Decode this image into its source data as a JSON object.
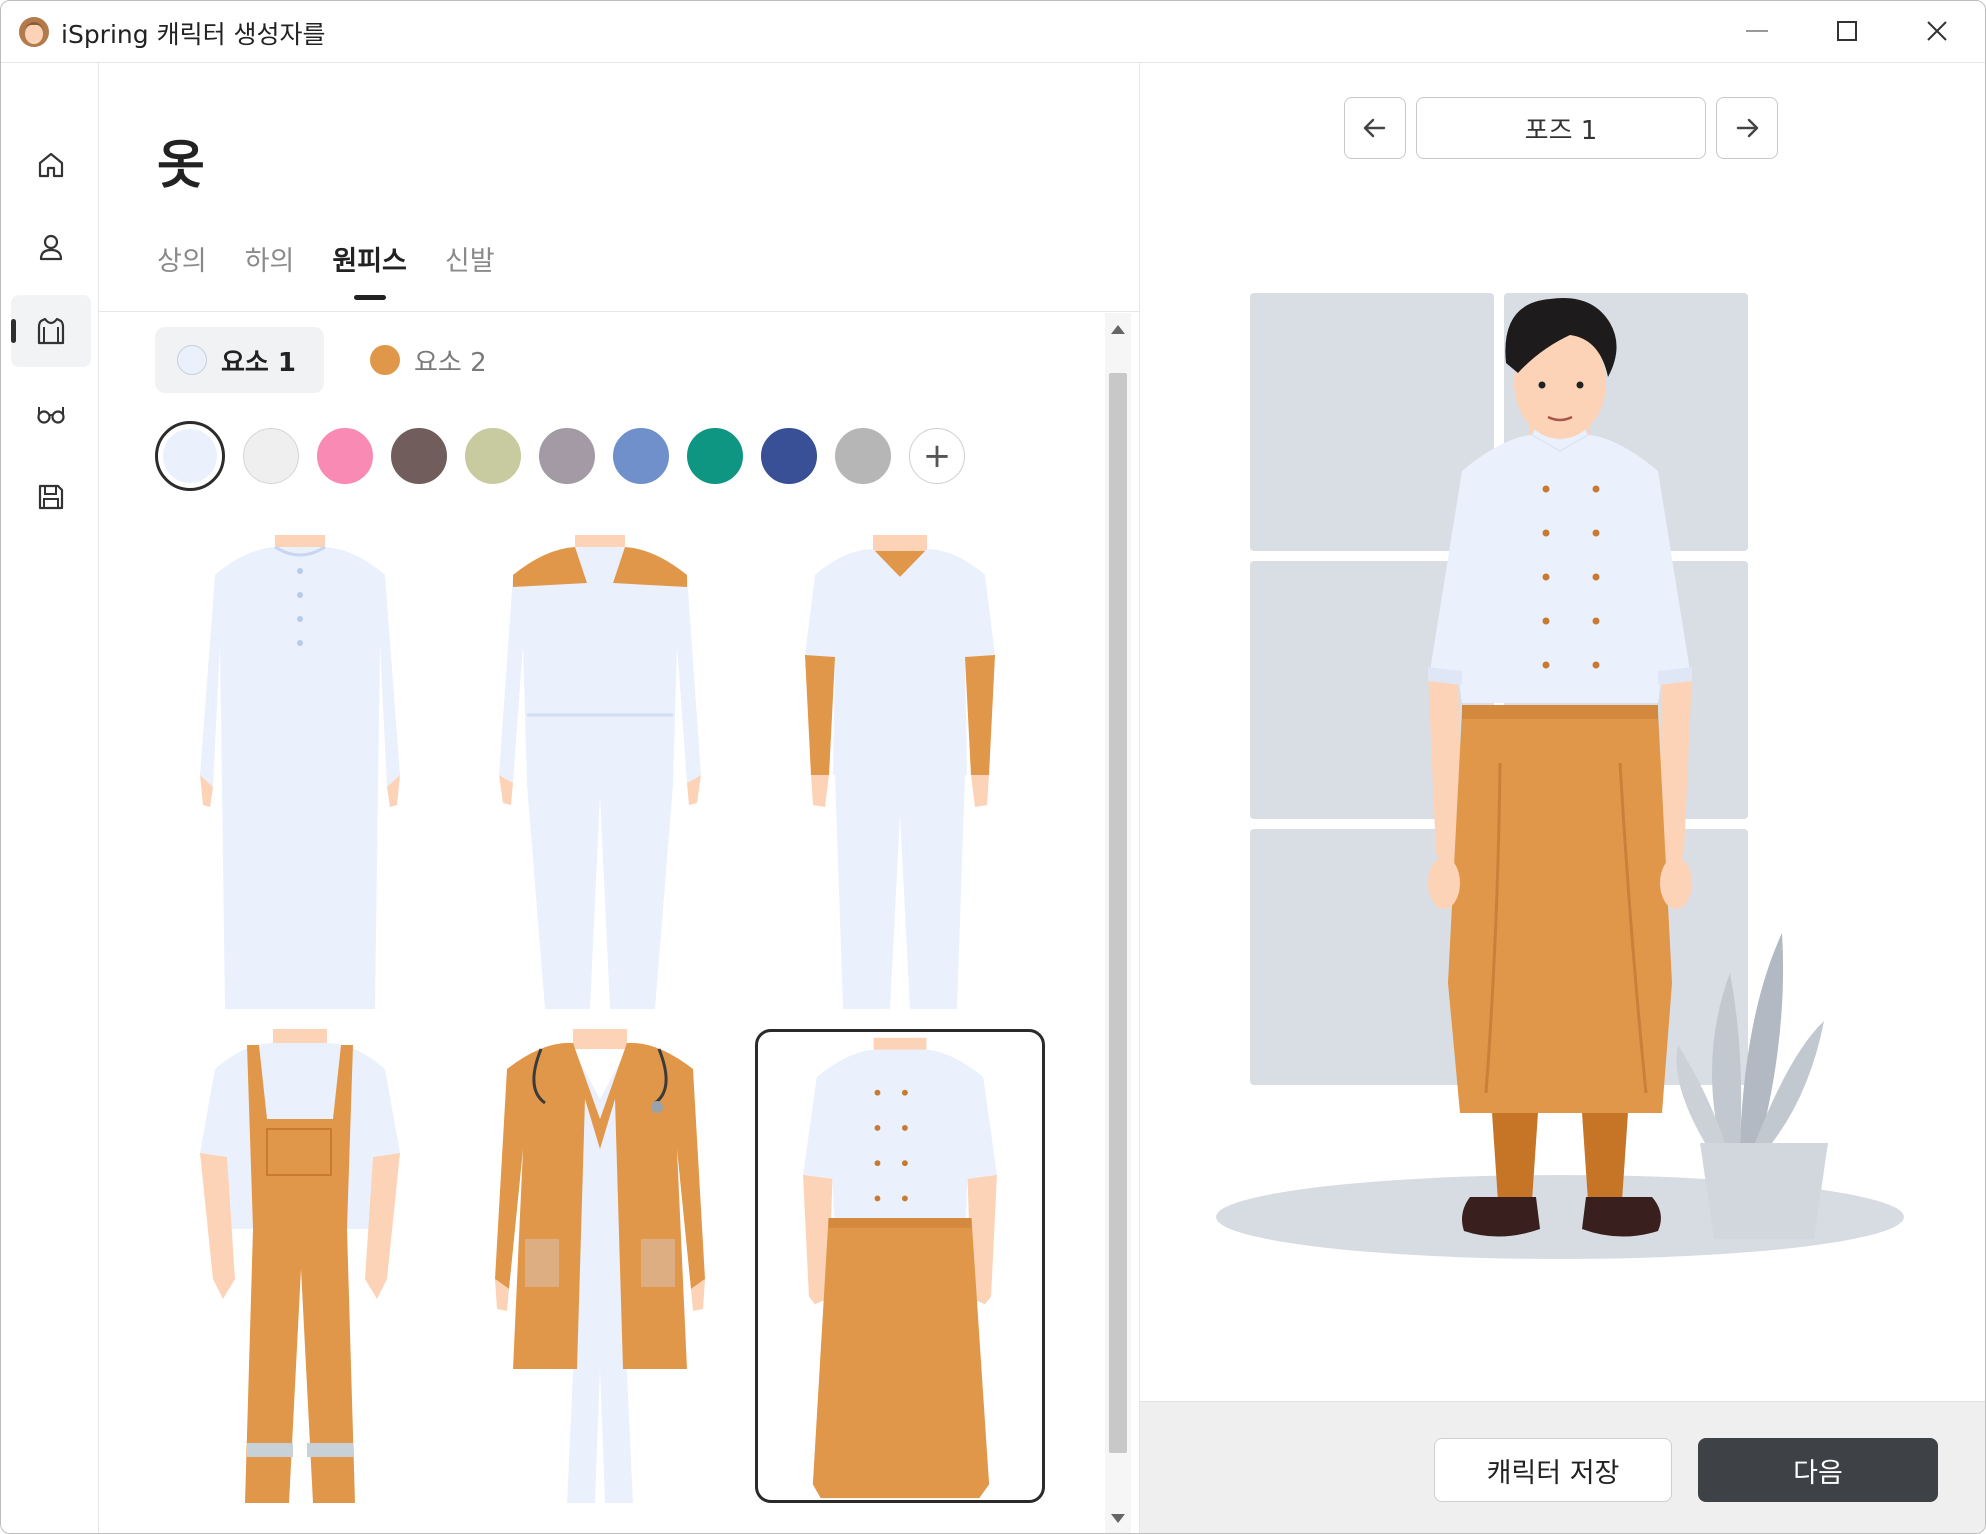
{
  "window": {
    "title": "iSpring 캐릭터 생성자를"
  },
  "sidebar": {
    "items": [
      {
        "name": "home",
        "icon": "home-icon",
        "active": false
      },
      {
        "name": "character",
        "icon": "person-icon",
        "active": false
      },
      {
        "name": "clothes",
        "icon": "shirt-icon",
        "active": true
      },
      {
        "name": "accessories",
        "icon": "glasses-icon",
        "active": false
      },
      {
        "name": "save",
        "icon": "save-icon",
        "active": false
      }
    ]
  },
  "panel": {
    "title": "옷",
    "tabs": [
      {
        "label": "상의",
        "active": false
      },
      {
        "label": "하의",
        "active": false
      },
      {
        "label": "원피스",
        "active": true
      },
      {
        "label": "신발",
        "active": false
      }
    ],
    "elements": [
      {
        "label": "요소 1",
        "color": "#eaf1fd",
        "active": true
      },
      {
        "label": "요소 2",
        "color": "#e0974a",
        "active": false
      }
    ],
    "swatches": [
      "#eaf1fd",
      "#efefef",
      "#f88ab3",
      "#715d5c",
      "#c8ca9f",
      "#a39aa6",
      "#7090cc",
      "#0f9683",
      "#394f96",
      "#b6b6b6"
    ],
    "selected_swatch": "#eaf1fd",
    "add_swatch_icon": "plus-icon",
    "outfits": [
      {
        "id": "long-robe",
        "selected": false
      },
      {
        "id": "jumpsuit",
        "selected": false
      },
      {
        "id": "scrubs",
        "selected": false
      },
      {
        "id": "overalls",
        "selected": false
      },
      {
        "id": "doctor-coat",
        "selected": false
      },
      {
        "id": "chef-apron",
        "selected": true
      }
    ]
  },
  "preview": {
    "pose_label": "포즈 1",
    "prev_icon": "arrow-left-icon",
    "next_icon": "arrow-right-icon",
    "save_label": "캐릭터 저장",
    "next_label": "다음"
  },
  "colors": {
    "accent": "#3e4145",
    "orange": "#e0974a",
    "white_garment": "#eaf1fd",
    "skin": "#fcd3b6"
  }
}
